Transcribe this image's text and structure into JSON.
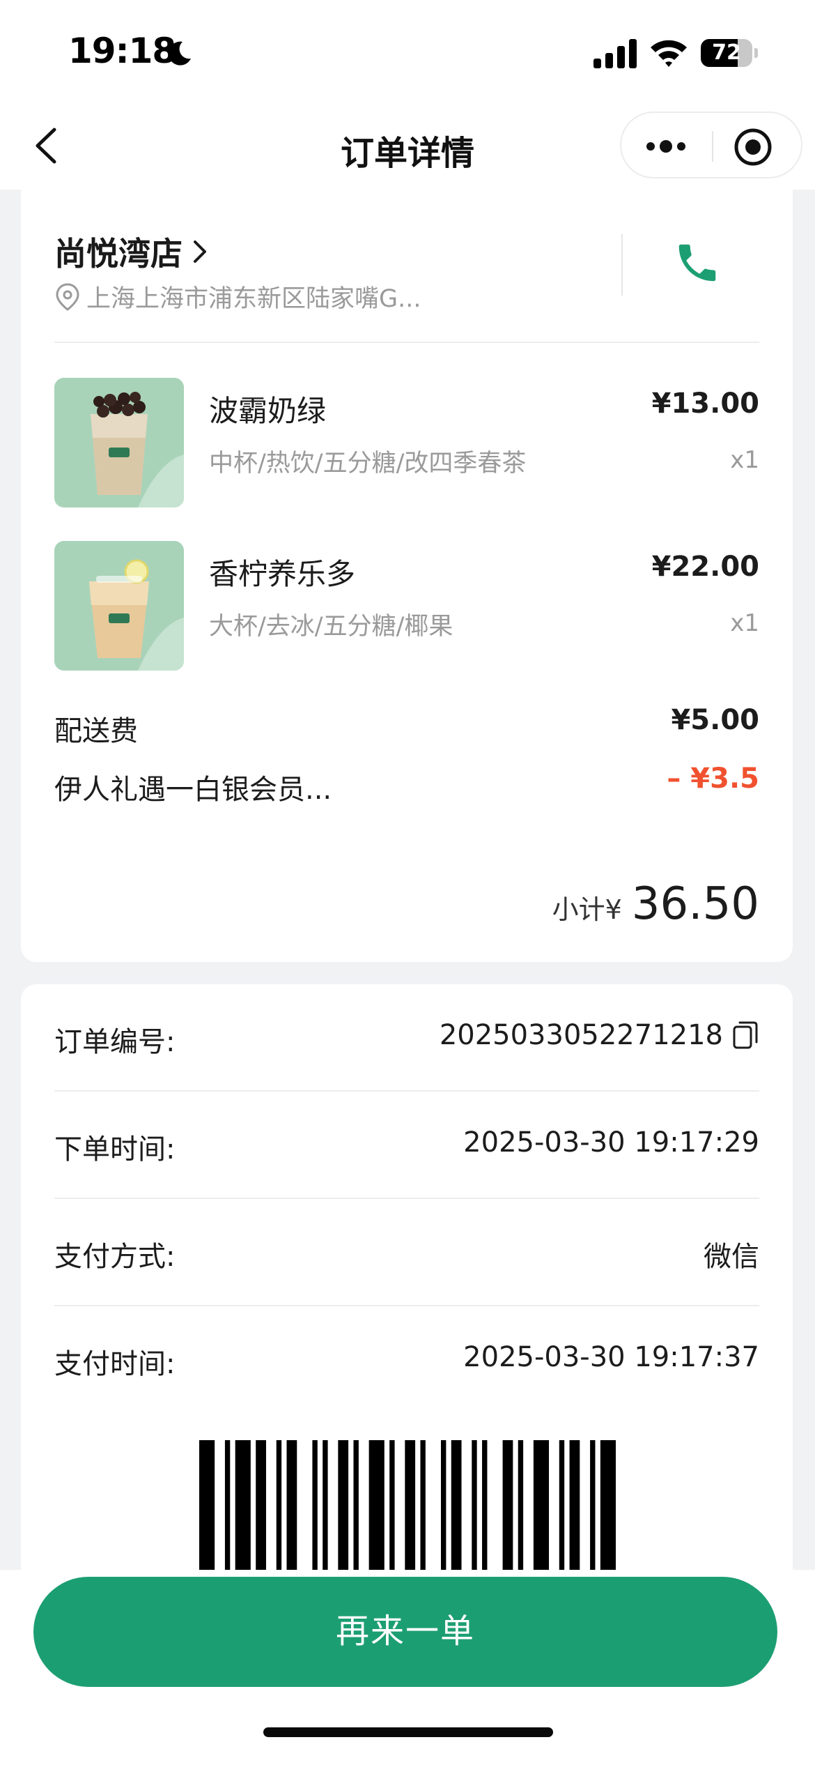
{
  "status_bar": {
    "time": "19:18",
    "battery_level": "72",
    "battery_fraction": 0.72,
    "icons": [
      "moon-icon",
      "signal-icon",
      "wifi-icon",
      "battery-icon"
    ]
  },
  "nav": {
    "title": "订单详情",
    "icons": [
      "back-chevron-icon",
      "more-dots-icon",
      "target-icon"
    ]
  },
  "store": {
    "name": "尚悦湾店",
    "address": "上海上海市浦东新区陆家嘴G...",
    "icons": [
      "chevron-right-icon",
      "location-pin-icon",
      "phone-icon"
    ]
  },
  "items": [
    {
      "name": "波霸奶绿",
      "spec": "中杯/热饮/五分糖/改四季春茶",
      "price": "¥13.00",
      "qty": "x1"
    },
    {
      "name": "香柠养乐多",
      "spec": "大杯/去冰/五分糖/椰果",
      "price": "¥22.00",
      "qty": "x1"
    }
  ],
  "fees": {
    "delivery_label": "配送费",
    "delivery_value": "¥5.00",
    "discount_label": "伊人礼遇一白银会员...",
    "discount_value": "– ¥3.5"
  },
  "subtotal": {
    "label": "小计",
    "currency": "¥",
    "value": "36.50"
  },
  "info": {
    "order_no_label": "订单编号:",
    "order_no_value": "2025033052271218",
    "order_time_label": "下单时间:",
    "order_time_value": "2025-03-30 19:17:29",
    "pay_method_label": "支付方式:",
    "pay_method_value": "微信",
    "pay_time_label": "支付时间:",
    "pay_time_value": "2025-03-30 19:17:37"
  },
  "actions": {
    "reorder_label": "再来一单"
  },
  "colors": {
    "brand_green": "#1c9e73",
    "discount_red": "#f0512f",
    "page_bg": "#f1f2f4"
  }
}
